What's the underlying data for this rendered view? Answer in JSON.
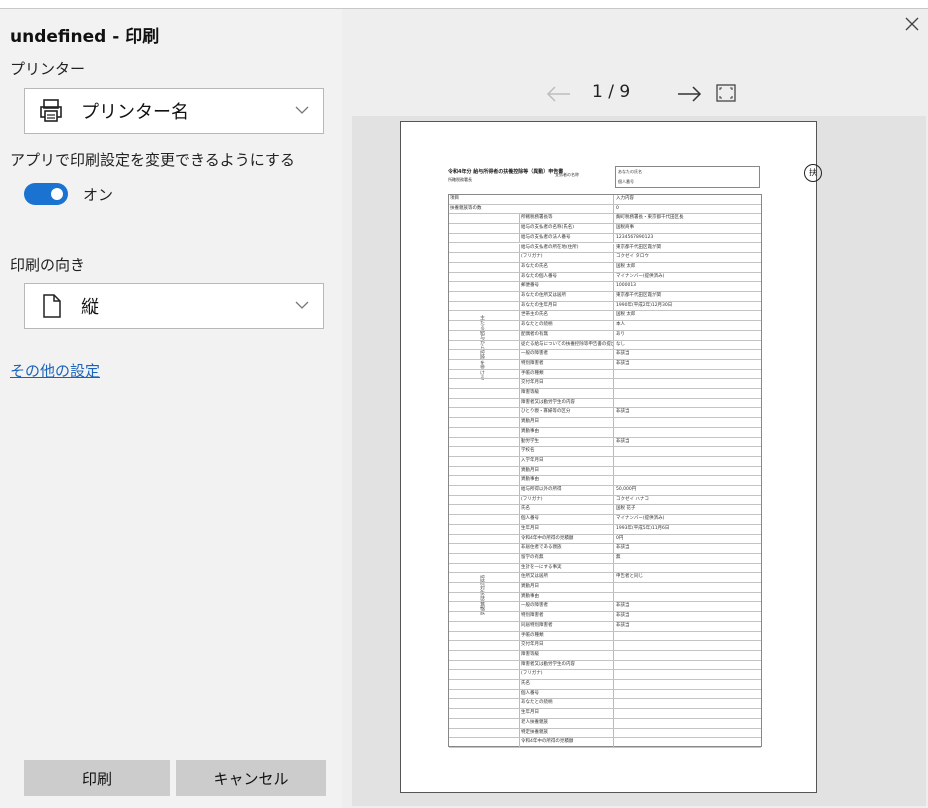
{
  "dialog": {
    "title": "undefined - 印刷",
    "printer_label": "プリンター",
    "printer_value": "プリンター名",
    "app_settings_label": "アプリで印刷設定を変更できるようにする",
    "toggle_state": "オン",
    "orientation_label": "印刷の向き",
    "orientation_value": "縦",
    "more_settings_link": "その他の設定",
    "print_button": "印刷",
    "cancel_button": "キャンセル",
    "accent_color": "#1a73d1"
  },
  "preview": {
    "page_indicator": "1 / 9"
  },
  "document": {
    "heading": "令和4年分 給与所得者の扶養控除等（異動）申告書",
    "seal_char": "扶",
    "header_labels": [
      "所轄税務署長",
      "支払者の名称",
      "あなたの氏名",
      "個人番号"
    ],
    "group_labels": [
      "主たる給与から控除を受ける",
      "控除対象扶養親族"
    ],
    "rows": [
      {
        "c1": "項目",
        "c2": "入力内容",
        "full": true
      },
      {
        "c1": "扶養親族等の数",
        "c2": "0",
        "full": true
      },
      {
        "c1": "所轄税務署長等",
        "c2": "麹町税務署長・東京都千代田区長"
      },
      {
        "c1": "給与の支払者の名称(氏名)",
        "c2": "国税商事"
      },
      {
        "c1": "給与の支払者の法人番号",
        "c2": "1234567890123"
      },
      {
        "c1": "給与の支払者の所在地(住所)",
        "c2": "東京都千代田区霞が関"
      },
      {
        "c1": "(フリガナ)",
        "c2": "コクゼイ タロウ"
      },
      {
        "c1": "あなたの氏名",
        "c2": "国税 太郎"
      },
      {
        "c1": "あなたの個人番号",
        "c2": "マイナンバー(提供済み)"
      },
      {
        "c1": "郵便番号",
        "c2": "1000013"
      },
      {
        "c1": "あなたの住所又は居所",
        "c2": "東京都千代田区霞が関"
      },
      {
        "c1": "あなたの生年月日",
        "c2": "1990年(平成2年)12月30日"
      },
      {
        "c1": "世帯主の氏名",
        "c2": "国税 太郎"
      },
      {
        "c1": "あなたとの続柄",
        "c2": "本人"
      },
      {
        "c1": "配偶者の有無",
        "c2": "あり"
      },
      {
        "c1": "従たる給与についての扶養控除等申告書の提出",
        "c2": "なし"
      },
      {
        "c1": "一般の障害者",
        "c2": "非該当"
      },
      {
        "c1": "特別障害者",
        "c2": "非該当"
      },
      {
        "c1": "  手帳の種類",
        "c2": ""
      },
      {
        "c1": "  交付年月日",
        "c2": ""
      },
      {
        "c1": "  障害等級",
        "c2": ""
      },
      {
        "c1": "  障害者又は勤労学生の内容",
        "c2": ""
      },
      {
        "c1": "ひとり親・寡婦等の区分",
        "c2": "非該当"
      },
      {
        "c1": "  異動月日",
        "c2": ""
      },
      {
        "c1": "  異動事由",
        "c2": ""
      },
      {
        "c1": "勤労学生",
        "c2": "非該当"
      },
      {
        "c1": "  学校名",
        "c2": ""
      },
      {
        "c1": "  入学年月日",
        "c2": ""
      },
      {
        "c1": "  異動月日",
        "c2": ""
      },
      {
        "c1": "  異動事由",
        "c2": ""
      },
      {
        "c1": "給与所得以外の所得",
        "c2": "50,000円"
      },
      {
        "c1": "(フリガナ)",
        "c2": "コクゼイ ハナコ"
      },
      {
        "c1": "氏名",
        "c2": "国税 花子"
      },
      {
        "c1": "個人番号",
        "c2": "マイナンバー(提供済み)"
      },
      {
        "c1": "生年月日",
        "c2": "1993年(平成5年)11月6日"
      },
      {
        "c1": "令和4年中の所得の見積額",
        "c2": "0円"
      },
      {
        "c1": "非居住者である親族",
        "c2": "非該当"
      },
      {
        "c1": "留学の有無",
        "c2": "無"
      },
      {
        "c1": "生計を一にする事実",
        "c2": ""
      },
      {
        "c1": "住所又は居所",
        "c2": "申告者と同じ"
      },
      {
        "c1": "異動月日",
        "c2": ""
      },
      {
        "c1": "異動事由",
        "c2": ""
      },
      {
        "c1": "一般の障害者",
        "c2": "非該当"
      },
      {
        "c1": "特別障害者",
        "c2": "非該当"
      },
      {
        "c1": "同居特別障害者",
        "c2": "非該当"
      },
      {
        "c1": "  手帳の種類",
        "c2": ""
      },
      {
        "c1": "  交付年月日",
        "c2": ""
      },
      {
        "c1": "  障害等級",
        "c2": ""
      },
      {
        "c1": "  障害者又は勤労学生の内容",
        "c2": ""
      },
      {
        "c1": "(フリガナ)",
        "c2": ""
      },
      {
        "c1": "氏名",
        "c2": ""
      },
      {
        "c1": "個人番号",
        "c2": ""
      },
      {
        "c1": "あなたとの続柄",
        "c2": ""
      },
      {
        "c1": "生年月日",
        "c2": ""
      },
      {
        "c1": "老人扶養親族",
        "c2": ""
      },
      {
        "c1": "特定扶養親族",
        "c2": ""
      },
      {
        "c1": "令和4年中の所得の見積額",
        "c2": ""
      }
    ]
  }
}
